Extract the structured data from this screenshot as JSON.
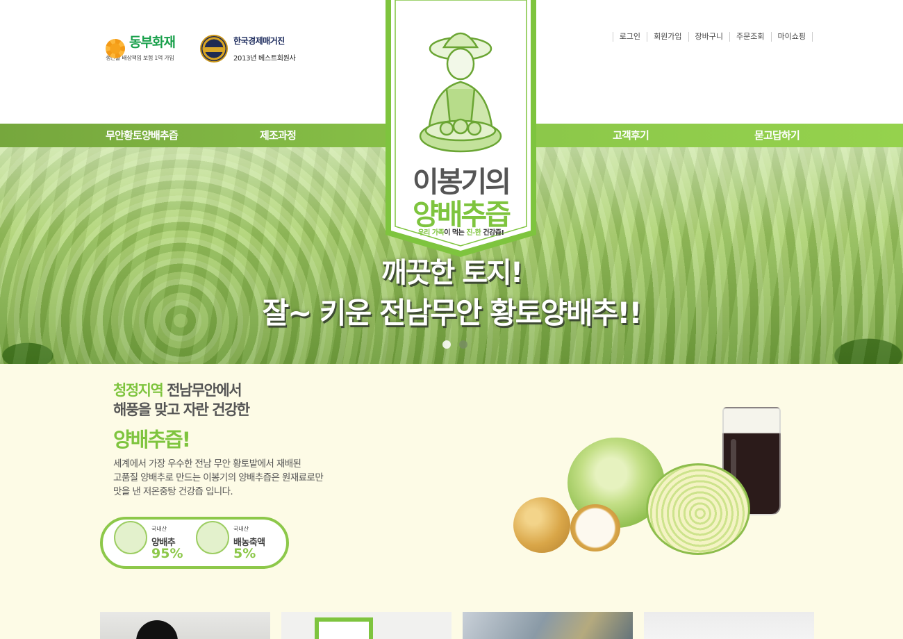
{
  "header": {
    "partner1": {
      "name": "동부화재",
      "sub": "생산물 배상책임 보험 1억 가입"
    },
    "partner2": {
      "name": "한국경제매거진",
      "sub": "2013년 베스트회원사"
    },
    "util_links": [
      "로그인",
      "회원가입",
      "장바구니",
      "주문조회",
      "마이쇼핑"
    ]
  },
  "nav": {
    "items": [
      "무안황토양배추즙",
      "제조과정",
      "고객후기",
      "묻고답하기"
    ]
  },
  "brand": {
    "line1": "이봉기의",
    "line2": "양배추즙",
    "tagline_a": "우리 가족",
    "tagline_b": "이 먹는 ",
    "tagline_c": "진-한",
    "tagline_d": " 건강즙!"
  },
  "hero": {
    "line1": "깨끗한 토지!",
    "line2": "잘~ 키운 전남무안 황토양배추!!",
    "slides_total": 2,
    "active_slide": 1
  },
  "intro": {
    "heading_green": "청정지역",
    "heading_rest1": " 전남무안에서",
    "heading_line2": "해풍을 맞고 자란 건강한",
    "product_title": "양배추즙!",
    "desc_line1": "세계에서 가장 우수한 전남 무안 황토밭에서 재배된",
    "desc_line2": "고품질 양배추로 만드는 이봉기의 양배추즙은 원재료로만",
    "desc_line3": "맛을 낸 저온중탕 건강즙 입니다.",
    "ingredients": [
      {
        "origin": "국내산",
        "name": "양배추",
        "percent": "95%"
      },
      {
        "origin": "국내산",
        "name": "배농축액",
        "percent": "5%"
      }
    ]
  },
  "colors": {
    "accent": "#7ec43e",
    "nav_bar": "#84b944",
    "intro_bg": "#fdfbe6"
  }
}
